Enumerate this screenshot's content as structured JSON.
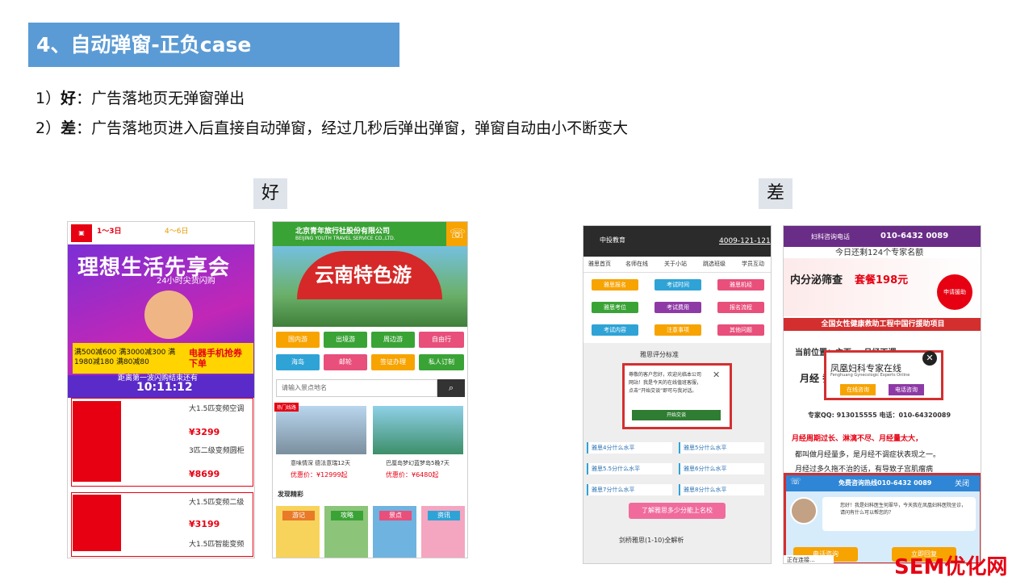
{
  "slide": {
    "title": "4、自动弹窗-正负case",
    "line1_label": "1）",
    "line1_bold": "好",
    "line1_text": "：广告落地页无弹窗弹出",
    "line2_label": "2）",
    "line2_bold": "差",
    "line2_text": "：广告落地页进入后直接自动弹窗，经过几秒后弹出弹窗，弹窗自动由小不断变大",
    "tag_good": "好",
    "tag_bad": "差",
    "watermark": "SEM优化网"
  },
  "phone1": {
    "t1": "1～3日",
    "t2": "4～6日",
    "hero_title": "理想生活先享会",
    "hero_sub": "24小时尖货闪购",
    "offer": "满500减600 满3000减300 满1980减180 满80减80",
    "phone_promo": "电器手机抢券下单",
    "timer_text": "距离第一波闪购结束还有",
    "timer": "10:11:12",
    "products": [
      {
        "name": "大1.5匹变频空调",
        "price": "¥3299"
      },
      {
        "name": "3匹二级变频圆柜",
        "price": "¥8699"
      },
      {
        "name": "大1.5匹变频二级",
        "price": "¥3199"
      },
      {
        "name": "大1.5匹智能变频",
        "price": ""
      }
    ]
  },
  "phone2": {
    "company": "北京青年旅行社股份有限公司",
    "company_en": "BEIJING YOUTH TRAVEL SERVICE CO.,LTD.",
    "hero_title": "云南特色游",
    "buttons": [
      "国内游",
      "出境游",
      "周边游",
      "自由行",
      "海岛",
      "邮轮",
      "签证办理",
      "私人订制"
    ],
    "search_placeholder": "请输入景点地名",
    "hot_tag": "热门线路",
    "card1_title": "意味情深 德法意瑞12天",
    "card1_price": "优惠价：¥12999起",
    "card2_title": "巴厘岛梦幻蓝梦岛5晚7天",
    "card2_price": "优惠价：¥6480起",
    "discover": "发现精彩",
    "tiles": [
      "游记",
      "攻略",
      "景点",
      "资讯"
    ]
  },
  "phone3": {
    "logo": "中投教育",
    "phone": "4009-121-121",
    "nav": [
      "雅思首页",
      "名师在线",
      "关于小站",
      "跳选班级",
      "学员互动"
    ],
    "buttons": [
      "雅思报名",
      "考试时间",
      "雅思机经",
      "雅思考位",
      "考试费用",
      "报名流程",
      "考试内容",
      "注意事项",
      "其他问题"
    ],
    "section_title": "雅思评分标准",
    "popup_text": "尊敬的客户您好，欢迎光临本公司网站！我是今天的在线值班客服，点击“开始交谈”即可与我对话。",
    "popup_close": "✕",
    "popup_btn": "开始交谈",
    "items": [
      "雅思4分什么水平",
      "雅思5分什么水平",
      "雅思5.5分什么水平",
      "雅思6分什么水平",
      "雅思7分什么水平",
      "雅思8分什么水平"
    ],
    "pink_btn": "了解雅思多少分能上名校",
    "bottom": "剑桥雅思(1-10)全解析"
  },
  "phone4": {
    "top_left": "妇科咨询电话",
    "top_right": "010-6432 0089",
    "sub": "今日还剩124个专家名额",
    "banner_title": "内分泌筛查",
    "banner_price": "套餐198元",
    "circle": "申请援助",
    "strip": "全国女性健康救助工程中国行援助项目",
    "position": "当前位置：主页 > 月经不调",
    "line1": "月经                       乔祸患",
    "qq": "专家QQ: 913015555    电话：010-64320089",
    "popup_title": "凤凰妇科专家在线",
    "popup_sub": "Fenghuang Gynecologic Experts Online",
    "popup_b1": "在线咨询",
    "popup_b2": "电话咨询",
    "popup_x": "✕",
    "red_text": "月经周期过长、淋漓不尽、月经量太大，",
    "dark_text": "都叫做月经量多，是月经不调症状表现之一。",
    "dark_text2": "月经过多久拖不治的话，有导致子宫肌瘤病",
    "chat_head": "免费咨询热线010-6432 0089",
    "chat_close": "关闭",
    "bubble": "您好！我是妇科医生何翠华，今天我在凤凰妇科医院坐诊，请问有什么可以帮您的？",
    "chat_b1": "电话咨询",
    "chat_b2": "立即回复",
    "status": "正在连接..."
  }
}
